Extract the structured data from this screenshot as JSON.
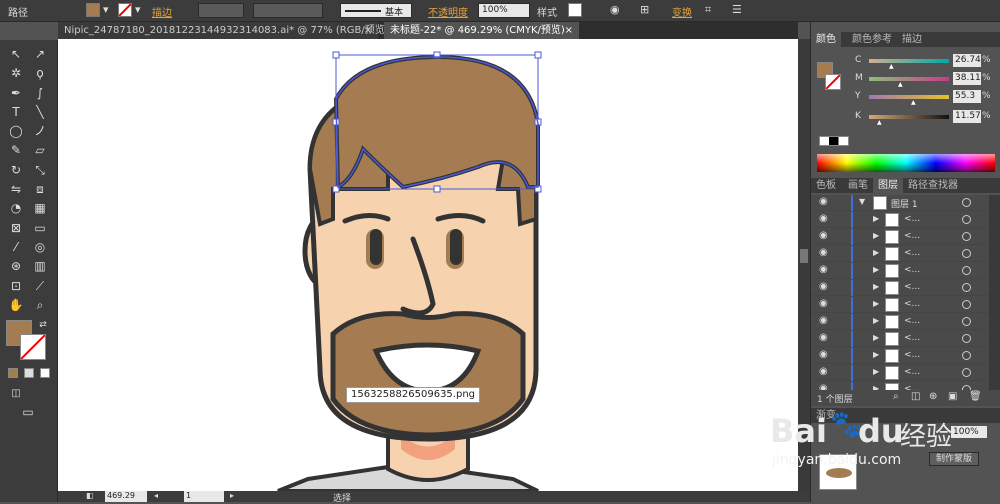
{
  "control_bar": {
    "object_type": "路径",
    "fill_color": "#a57c52",
    "stroke_label": "描边",
    "profile_label": "基本",
    "opacity_label": "不透明度",
    "opacity_value": "100%",
    "style_label": "样式",
    "transform_label": "变换"
  },
  "doc_tabs": [
    {
      "label": "Nipic_24787180_20181223144932314083.ai* @ 77% (RGB/预览)"
    },
    {
      "label": "未标题-22* @ 469.29% (CMYK/预览)"
    }
  ],
  "canvas": {
    "tooltip_filename": "1563258826509635.png",
    "colors": {
      "hair": "#a57c52",
      "skin": "#f7d2ae",
      "outline": "#333333",
      "neck_shadow": "#f3a07f",
      "shirt": "#d8d8d8",
      "selection": "#4a5ad8"
    }
  },
  "color_panel": {
    "tabs": [
      "颜色",
      "颜色参考",
      "描边"
    ],
    "channels": [
      {
        "label": "C",
        "value": "26.74",
        "unit": "%",
        "from": "#ffffff",
        "to": "#00a7a7"
      },
      {
        "label": "M",
        "value": "38.11",
        "unit": "%",
        "from": "#ffffff",
        "to": "#c73c8a"
      },
      {
        "label": "Y",
        "value": "55.3",
        "unit": "%",
        "from": "#ffffff",
        "to": "#e4c028"
      },
      {
        "label": "K",
        "value": "11.57",
        "unit": "%",
        "from": "#ffffff",
        "to": "#000000"
      }
    ]
  },
  "layers_panel": {
    "tabs": [
      "色板",
      "画笔",
      "图层",
      "路径查找器"
    ],
    "top_layer": "图层 1",
    "sublayers": [
      "<...",
      "<...",
      "<...",
      "<...",
      "<...",
      "<...",
      "<...",
      "<...",
      "<...",
      "<...",
      "<..."
    ],
    "count_label": "1 个图层"
  },
  "transparency_panel": {
    "tab_label": "渐变",
    "opacity_value": "100%",
    "make_mask_button": "制作蒙版"
  },
  "status_bar": {
    "zoom": "469.29",
    "page": "1",
    "tool": "选择"
  },
  "watermark": {
    "logo_text": "Bai",
    "logo_text2": "du",
    "site_cn": "经验",
    "url": "jingyan.baidu.com"
  }
}
